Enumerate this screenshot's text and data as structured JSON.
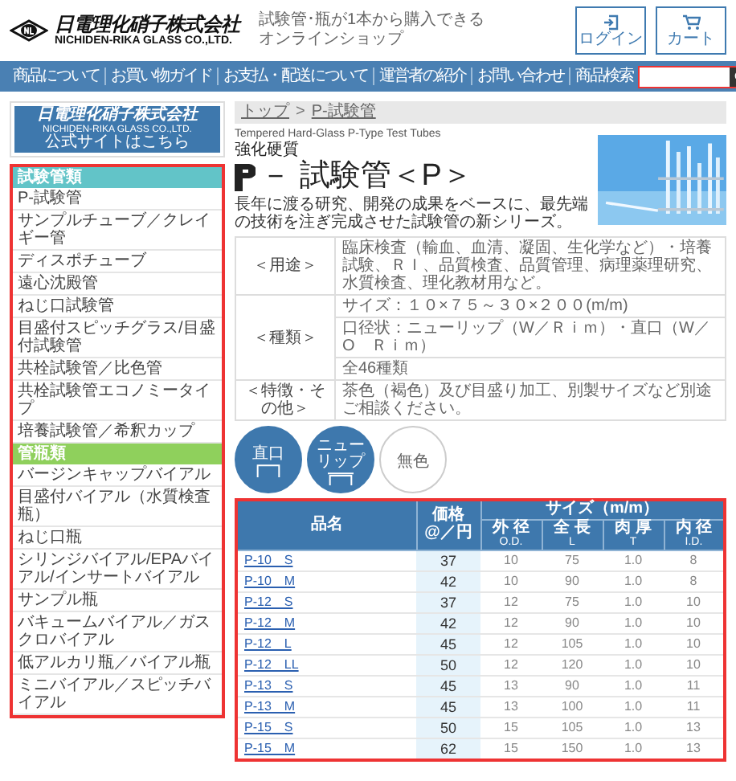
{
  "header": {
    "company_name": "日電理化硝子株式会社",
    "company_name_en": "NICHIDEN-RIKA GLASS CO.,LTD.",
    "tagline": [
      "試験管･瓶が1本から購入できる",
      "オンラインショップ"
    ],
    "buttons": [
      {
        "label": "ログイン",
        "kind": "login"
      },
      {
        "label": "カート",
        "kind": "cart"
      }
    ]
  },
  "nav": {
    "items": [
      "商品について",
      "お買い物ガイド",
      "お支払・配送について",
      "運営者の紹介",
      "お問い合わせ",
      "商品検索"
    ]
  },
  "sidebar": {
    "banner": {
      "name": "日電理化硝子株式会社",
      "name_en": "NICHIDEN-RIKA GLASS CO.,LTD.",
      "link": "公式サイトはこちら"
    },
    "sections": [
      {
        "title": "試験管類",
        "color": "#62c4c8",
        "items": [
          "P-試験管",
          "サンプルチューブ／クレイギー管",
          "ディスポチューブ",
          "遠心沈殿管",
          "ねじ口試験管",
          "目盛付スピッチグラス/目盛付試験管",
          "共栓試験管／比色管",
          "共栓試験管エコノミータイプ",
          "培養試験管／希釈カップ"
        ]
      },
      {
        "title": "管瓶類",
        "color": "#8fd05c",
        "items": [
          "バージンキャップバイアル",
          "目盛付バイアル（水質検査瓶）",
          "ねじ口瓶",
          "シリンジバイアル/EPAバイアル/インサートバイアル",
          "サンプル瓶",
          "バキュームバイアル／ガスクロバイアル",
          "低アルカリ瓶／バイアル瓶",
          "ミニバイアル／スピッチバイアル"
        ]
      }
    ]
  },
  "breadcrumb": {
    "items": [
      "トップ",
      "P-試験管"
    ],
    "separator": ">"
  },
  "product": {
    "subtitle_en": "Tempered Hard-Glass P-Type Test Tubes",
    "category": "強化硬質",
    "title": "－ 試験管＜P＞",
    "description": "長年に渡る研究、開発の成果をベースに、最先端の技術を注ぎ完成させた試験管の新シリーズ。"
  },
  "specs": [
    {
      "label": "＜用途＞",
      "values": [
        "臨床検査（輸血、血清、凝固、生化学など）・培養試験、ＲＩ、品質検査、品質管理、病理薬理研究、水質検査、理化教材用など。"
      ]
    },
    {
      "label": "＜種類＞",
      "values": [
        "サイズ：１０×７５～３０×２００(m/m)",
        "口径状：ニューリップ（W／Ｒｉｍ）・直口（W／O　Ｒｉｍ）",
        "全46種類"
      ]
    },
    {
      "label": "＜特徴・その他＞",
      "values": [
        "茶色（褐色）及び目盛り加工、別製サイズなど別途ご相談ください。"
      ]
    }
  ],
  "badges": [
    {
      "label": "直口",
      "kind": "straight"
    },
    {
      "label": "ニューリップ",
      "kind": "lip"
    },
    {
      "label": "無色",
      "kind": "plain"
    }
  ],
  "table": {
    "name_header": "品名",
    "price_header": [
      "価格",
      "@／円"
    ],
    "size_header": "サイズ（m/m）",
    "size_columns": [
      {
        "label": "外 径",
        "sub": "O.D."
      },
      {
        "label": "全 長",
        "sub": "L"
      },
      {
        "label": "肉 厚",
        "sub": "T"
      },
      {
        "label": "内 径",
        "sub": "I.D."
      }
    ],
    "rows": [
      {
        "name": "P-10　S",
        "price": "37",
        "values": [
          "10",
          "75",
          "1.0",
          "8"
        ]
      },
      {
        "name": "P-10　M",
        "price": "42",
        "values": [
          "10",
          "90",
          "1.0",
          "8"
        ]
      },
      {
        "name": "P-12　S",
        "price": "37",
        "values": [
          "12",
          "75",
          "1.0",
          "10"
        ]
      },
      {
        "name": "P-12　M",
        "price": "42",
        "values": [
          "12",
          "90",
          "1.0",
          "10"
        ]
      },
      {
        "name": "P-12　L",
        "price": "45",
        "values": [
          "12",
          "105",
          "1.0",
          "10"
        ]
      },
      {
        "name": "P-12　LL",
        "price": "50",
        "values": [
          "12",
          "120",
          "1.0",
          "10"
        ]
      },
      {
        "name": "P-13　S",
        "price": "45",
        "values": [
          "13",
          "90",
          "1.0",
          "11"
        ]
      },
      {
        "name": "P-13　M",
        "price": "45",
        "values": [
          "13",
          "100",
          "1.0",
          "11"
        ]
      },
      {
        "name": "P-15　S",
        "price": "50",
        "values": [
          "15",
          "105",
          "1.0",
          "13"
        ]
      },
      {
        "name": "P-15　M",
        "price": "62",
        "values": [
          "15",
          "150",
          "1.0",
          "13"
        ]
      }
    ]
  }
}
